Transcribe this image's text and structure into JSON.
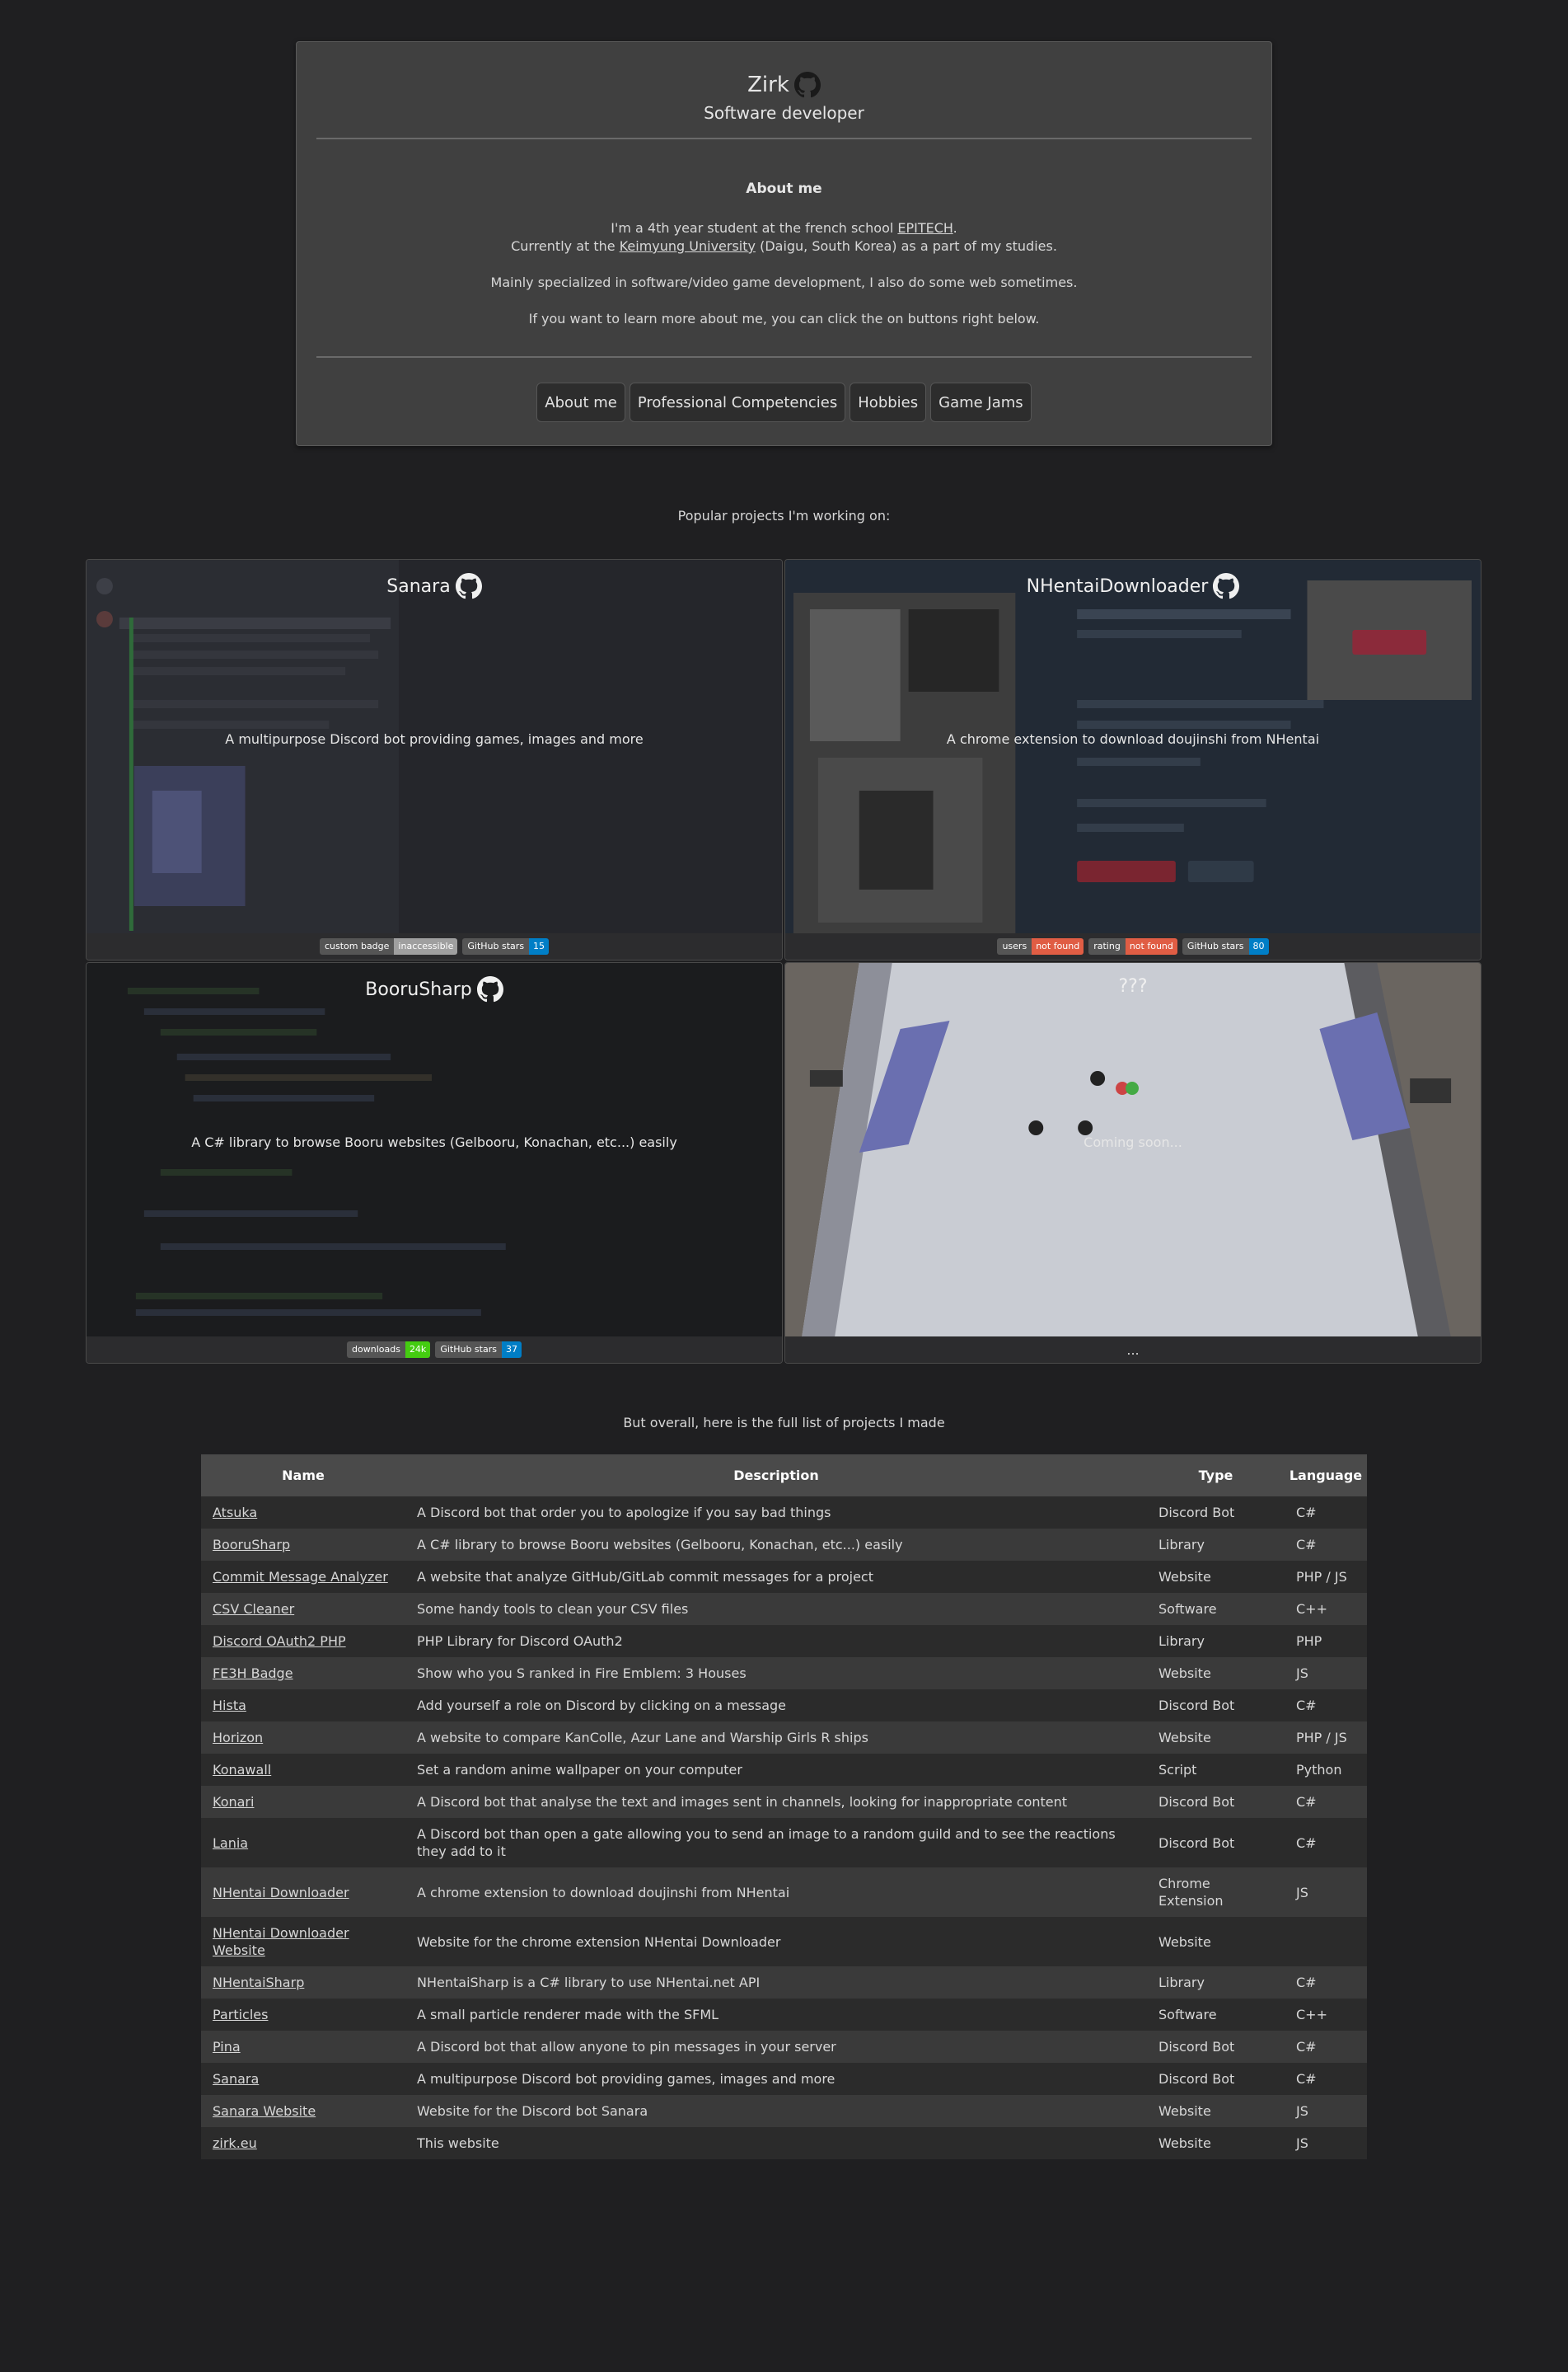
{
  "profile": {
    "name": "Zirk",
    "role": "Software developer",
    "about_title": "About me",
    "p1_a": "I'm a 4th year student at the french school ",
    "p1_link": "EPITECH",
    "p1_b": ".",
    "p1_c": "Currently at the ",
    "p1_link2": "Keimyung University",
    "p1_d": " (Daigu, South Korea) as a part of my studies.",
    "p2": "Mainly specialized in software/video game development, I also do some web sometimes.",
    "p3": "If you want to learn more about me, you can click the on buttons right below.",
    "buttons": [
      "About me",
      "Professional Competencies",
      "Hobbies",
      "Game Jams"
    ]
  },
  "popular_label": "Popular projects I'm working on:",
  "cards": [
    {
      "title": "Sanara",
      "desc": "A multipurpose Discord bot providing games, images and more",
      "badges": [
        {
          "k": "custom badge",
          "v": "inaccessible",
          "color": "#9f9f9f"
        },
        {
          "k": "GitHub stars",
          "v": "15",
          "color": "#007ec6"
        }
      ]
    },
    {
      "title": "NHentaiDownloader",
      "desc": "A chrome extension to download doujinshi from NHentai",
      "badges": [
        {
          "k": "users",
          "v": "not found",
          "color": "#e05d44"
        },
        {
          "k": "rating",
          "v": "not found",
          "color": "#e05d44"
        },
        {
          "k": "GitHub stars",
          "v": "80",
          "color": "#007ec6"
        }
      ]
    },
    {
      "title": "BooruSharp",
      "desc": "A C# library to browse Booru websites (Gelbooru, Konachan, etc...) easily",
      "badges": [
        {
          "k": "downloads",
          "v": "24k",
          "color": "#4c1"
        },
        {
          "k": "GitHub stars",
          "v": "37",
          "color": "#007ec6"
        }
      ]
    },
    {
      "title": "???",
      "desc": "Coming soon...",
      "footer": "..."
    }
  ],
  "table_label": "But overall, here is the full list of projects I made",
  "table": {
    "headers": [
      "Name",
      "Description",
      "Type",
      "Language"
    ],
    "rows": [
      [
        "Atsuka",
        "A Discord bot that order you to apologize if you say bad things",
        "Discord Bot",
        "C#"
      ],
      [
        "BooruSharp",
        "A C# library to browse Booru websites (Gelbooru, Konachan, etc...) easily",
        "Library",
        "C#"
      ],
      [
        "Commit Message Analyzer",
        "A website that analyze GitHub/GitLab commit messages for a project",
        "Website",
        "PHP / JS"
      ],
      [
        "CSV Cleaner",
        "Some handy tools to clean your CSV files",
        "Software",
        "C++"
      ],
      [
        "Discord OAuth2 PHP",
        "PHP Library for Discord OAuth2",
        "Library",
        "PHP"
      ],
      [
        "FE3H Badge",
        "Show who you S ranked in Fire Emblem: 3 Houses",
        "Website",
        "JS"
      ],
      [
        "Hista",
        "Add yourself a role on Discord by clicking on a message",
        "Discord Bot",
        "C#"
      ],
      [
        "Horizon",
        "A website to compare KanColle, Azur Lane and Warship Girls R ships",
        "Website",
        "PHP / JS"
      ],
      [
        "Konawall",
        "Set a random anime wallpaper on your computer",
        "Script",
        "Python"
      ],
      [
        "Konari",
        "A Discord bot that analyse the text and images sent in channels, looking for inappropriate content",
        "Discord Bot",
        "C#"
      ],
      [
        "Lania",
        "A Discord bot than open a gate allowing you to send an image to a random guild and to see the reactions they add to it",
        "Discord Bot",
        "C#"
      ],
      [
        "NHentai Downloader",
        "A chrome extension to download doujinshi from NHentai",
        "Chrome Extension",
        "JS"
      ],
      [
        "NHentai Downloader Website",
        "Website for the chrome extension NHentai Downloader",
        "Website",
        ""
      ],
      [
        "NHentaiSharp",
        "NHentaiSharp is a C# library to use NHentai.net API",
        "Library",
        "C#"
      ],
      [
        "Particles",
        "A small particle renderer made with the SFML",
        "Software",
        "C++"
      ],
      [
        "Pina",
        "A Discord bot that allow anyone to pin messages in your server",
        "Discord Bot",
        "C#"
      ],
      [
        "Sanara",
        "A multipurpose Discord bot providing games, images and more",
        "Discord Bot",
        "C#"
      ],
      [
        "Sanara Website",
        "Website for the Discord bot Sanara",
        "Website",
        "JS"
      ],
      [
        "zirk.eu",
        "This website",
        "Website",
        "JS"
      ]
    ]
  }
}
